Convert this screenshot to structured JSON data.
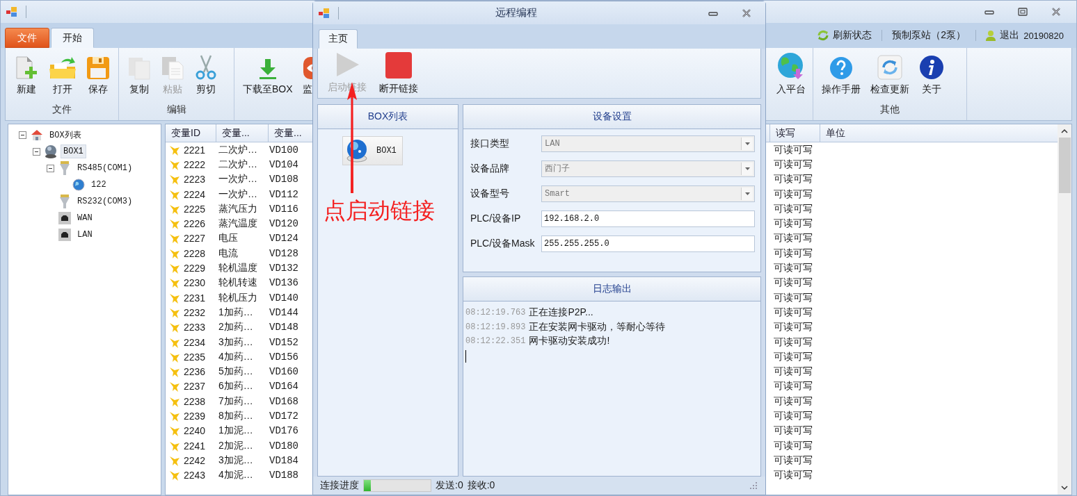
{
  "main_window": {
    "controls": [
      {
        "kind": "minimize"
      },
      {
        "kind": "maximize"
      },
      {
        "kind": "close"
      }
    ]
  },
  "ribbon": {
    "tabs": [
      {
        "label": "文件",
        "kind": "file",
        "selected": false
      },
      {
        "label": "开始",
        "kind": "tab",
        "selected": true
      }
    ],
    "status_items": [
      {
        "label": "刷新状态",
        "kind": "refresh"
      },
      {
        "label": "预制泵站（2泵）",
        "kind": "text"
      },
      {
        "label": "退出",
        "kind": "user",
        "detail": "20190820"
      }
    ],
    "groups": [
      {
        "label": "文件",
        "buttons": [
          {
            "label": "新建",
            "kind": "new",
            "disabled": false
          },
          {
            "label": "打开",
            "kind": "open",
            "disabled": false
          },
          {
            "label": "保存",
            "kind": "save",
            "disabled": false
          }
        ]
      },
      {
        "label": "编辑",
        "buttons": [
          {
            "label": "复制",
            "kind": "copy",
            "disabled": false
          },
          {
            "label": "粘贴",
            "kind": "paste",
            "disabled": true
          },
          {
            "label": "剪切",
            "kind": "cut",
            "disabled": false
          }
        ]
      },
      {
        "buttons": [
          {
            "label": "下载至BOX",
            "kind": "download",
            "disabled": false
          },
          {
            "label": "监",
            "kind": "monitor",
            "disabled": false
          }
        ],
        "trailing_buttons": [
          {
            "label": "入平台",
            "kind": "platform",
            "disabled": false
          }
        ]
      },
      {
        "label": "其他",
        "buttons": [
          {
            "label": "操作手册",
            "kind": "manual",
            "disabled": false
          },
          {
            "label": "检查更新",
            "kind": "update",
            "disabled": false
          },
          {
            "label": "关于",
            "kind": "about",
            "disabled": false
          }
        ]
      }
    ]
  },
  "tree": {
    "nodes": [
      {
        "label": "BOX列表",
        "kind": "home",
        "selected": false,
        "expanded": true,
        "children": [
          {
            "label": "BOX1",
            "kind": "box",
            "selected": true,
            "expanded": true,
            "children": [
              {
                "label": "RS485(COM1)",
                "kind": "port",
                "selected": false,
                "expanded": true,
                "children": [
                  {
                    "label": "122",
                    "kind": "device",
                    "selected": false
                  }
                ]
              },
              {
                "label": "RS232(COM3)",
                "kind": "port",
                "selected": false
              },
              {
                "label": "WAN",
                "kind": "ethernet",
                "selected": false
              },
              {
                "label": "LAN",
                "kind": "ethernet",
                "selected": false
              }
            ]
          }
        ]
      }
    ]
  },
  "table": {
    "columns": [
      {
        "label": "变量ID"
      },
      {
        "label": "变量..."
      },
      {
        "label": "变量..."
      },
      {
        "label": "读写"
      },
      {
        "label": "单位"
      }
    ],
    "rows": [
      {
        "id": "2221",
        "name": "二次炉…",
        "address": "VD100",
        "access": "可读可写"
      },
      {
        "id": "2222",
        "name": "二次炉…",
        "address": "VD104",
        "access": "可读可写"
      },
      {
        "id": "2223",
        "name": "一次炉…",
        "address": "VD108",
        "access": "可读可写"
      },
      {
        "id": "2224",
        "name": "一次炉…",
        "address": "VD112",
        "access": "可读可写"
      },
      {
        "id": "2225",
        "name": "蒸汽压力",
        "address": "VD116",
        "access": "可读可写"
      },
      {
        "id": "2226",
        "name": "蒸汽温度",
        "address": "VD120",
        "access": "可读可写"
      },
      {
        "id": "2227",
        "name": "电压",
        "address": "VD124",
        "access": "可读可写"
      },
      {
        "id": "2228",
        "name": "电流",
        "address": "VD128",
        "access": "可读可写"
      },
      {
        "id": "2229",
        "name": "轮机温度",
        "address": "VD132",
        "access": "可读可写"
      },
      {
        "id": "2230",
        "name": "轮机转速",
        "address": "VD136",
        "access": "可读可写"
      },
      {
        "id": "2231",
        "name": "轮机压力",
        "address": "VD140",
        "access": "可读可写"
      },
      {
        "id": "2232",
        "name": "1加药…",
        "address": "VD144",
        "access": "可读可写"
      },
      {
        "id": "2233",
        "name": "2加药…",
        "address": "VD148",
        "access": "可读可写"
      },
      {
        "id": "2234",
        "name": "3加药…",
        "address": "VD152",
        "access": "可读可写"
      },
      {
        "id": "2235",
        "name": "4加药…",
        "address": "VD156",
        "access": "可读可写"
      },
      {
        "id": "2236",
        "name": "5加药…",
        "address": "VD160",
        "access": "可读可写"
      },
      {
        "id": "2237",
        "name": "6加药…",
        "address": "VD164",
        "access": "可读可写"
      },
      {
        "id": "2238",
        "name": "7加药…",
        "address": "VD168",
        "access": "可读可写"
      },
      {
        "id": "2239",
        "name": "8加药…",
        "address": "VD172",
        "access": "可读可写"
      },
      {
        "id": "2240",
        "name": "1加泥…",
        "address": "VD176",
        "access": "可读可写"
      },
      {
        "id": "2241",
        "name": "2加泥…",
        "address": "VD180",
        "access": "可读可写"
      },
      {
        "id": "2242",
        "name": "3加泥…",
        "address": "VD184",
        "access": "可读可写"
      },
      {
        "id": "2243",
        "name": "4加泥…",
        "address": "VD188",
        "access": "可读可写"
      }
    ]
  },
  "dialog": {
    "title": "远程编程",
    "controls": [
      {
        "kind": "minimize"
      },
      {
        "kind": "close"
      }
    ],
    "tabs": [
      {
        "label": "主页",
        "selected": true
      }
    ],
    "toolbar": [
      {
        "label": "启动链接",
        "kind": "play",
        "disabled": true
      },
      {
        "label": "断开链接",
        "kind": "stop",
        "disabled": false
      }
    ],
    "box_list": {
      "title": "BOX列表",
      "items": [
        {
          "label": "BOX1"
        }
      ]
    },
    "device_settings": {
      "title": "设备设置",
      "fields": [
        {
          "label": "接口类型",
          "kind": "select",
          "value": "LAN",
          "disabled": true
        },
        {
          "label": "设备品牌",
          "kind": "select",
          "value": "西门子",
          "disabled": true
        },
        {
          "label": "设备型号",
          "kind": "select",
          "value": "Smart",
          "disabled": true
        },
        {
          "label": "PLC/设备IP",
          "kind": "text",
          "value": "192.168.2.0",
          "disabled": false
        },
        {
          "label": "PLC/设备Mask",
          "kind": "text",
          "value": "255.255.255.0",
          "disabled": false
        }
      ]
    },
    "log": {
      "title": "日志输出",
      "lines": [
        {
          "time": "08:12:19.763",
          "message": "正在连接P2P..."
        },
        {
          "time": "08:12:19.893",
          "message": "正在安装网卡驱动，等耐心等待"
        },
        {
          "time": "08:12:22.351",
          "message": "网卡驱动安装成功!"
        }
      ]
    },
    "status_bar": {
      "progress_label": "连接进度",
      "level": 0.1,
      "sent": "发送:0",
      "received": "接收:0"
    }
  },
  "annotation": {
    "text": "点启动链接"
  }
}
